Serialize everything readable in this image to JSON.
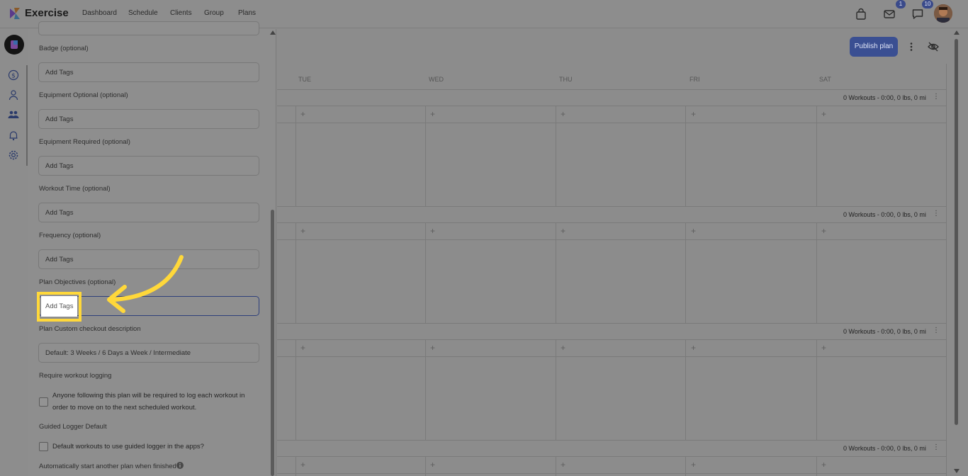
{
  "app": {
    "name": "Exercise"
  },
  "nav": [
    "Dashboard",
    "Schedule",
    "Clients",
    "Group",
    "Plans"
  ],
  "header": {
    "mail_badge": "1",
    "chat_badge": "10"
  },
  "rail_icons": [
    "dollar-icon",
    "person-icon",
    "group-icon",
    "bell-icon",
    "gear-icon"
  ],
  "form": {
    "badge_label": "Badge (optional)",
    "equip_opt_label": "Equipment Optional (optional)",
    "equip_req_label": "Equipment Required (optional)",
    "workout_time_label": "Workout Time (optional)",
    "frequency_label": "Frequency (optional)",
    "objectives_label": "Plan Objectives (optional)",
    "custom_checkout_label": "Plan Custom checkout description",
    "custom_checkout_placeholder": "Default: 3 Weeks / 6 Days a Week / Intermediate",
    "tags_placeholder": "Add Tags",
    "require_logging_label": "Require workout logging",
    "require_logging_text": "Anyone following this plan will be required to log each workout in order to move on to the next scheduled workout.",
    "guided_label": "Guided Logger Default",
    "guided_text": "Default workouts to use guided logger in the apps?",
    "auto_start_label": "Automatically start another plan when finished"
  },
  "calendar": {
    "publish_label": "Publish plan",
    "days": [
      "TUE",
      "WED",
      "THU",
      "FRI",
      "SAT"
    ],
    "week_summary": "0 Workouts - 0:00, 0 lbs, 0 mi",
    "add_symbol": "+"
  },
  "colors": {
    "accent": "#3a4f92",
    "highlight": "#ffd83a"
  }
}
